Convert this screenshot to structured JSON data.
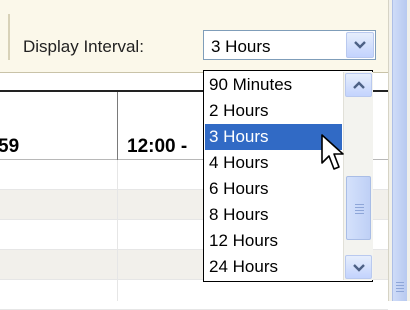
{
  "toolbar": {
    "display_interval_label": "Display Interval:"
  },
  "interval_select": {
    "selected": "3 Hours",
    "options": [
      "90 Minutes",
      "2 Hours",
      "3 Hours",
      "4 Hours",
      "6 Hours",
      "8 Hours",
      "12 Hours",
      "24 Hours"
    ],
    "highlighted_index": 2
  },
  "grid": {
    "headers": [
      "59",
      "12:00 -"
    ]
  },
  "icons": {
    "select_button": "chevron-down-icon",
    "scroll_up": "arrow-up-icon",
    "scroll_down": "arrow-down-icon",
    "cursor": "mouse-pointer-icon"
  },
  "colors": {
    "highlight": "#316ac5",
    "toolbar_bg": "#fbf8ea"
  }
}
